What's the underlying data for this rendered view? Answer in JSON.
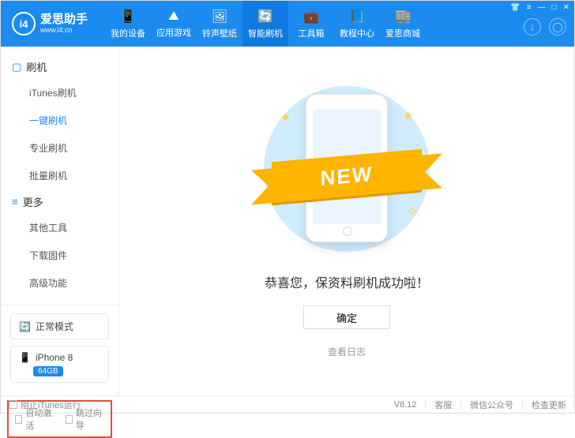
{
  "brand": {
    "icon_text": "i4",
    "name": "爱思助手",
    "site": "www.i4.cn"
  },
  "nav": [
    {
      "label": "我的设备",
      "icon": "📱"
    },
    {
      "label": "应用游戏",
      "icon": "⛰"
    },
    {
      "label": "铃声壁纸",
      "icon": "🖼"
    },
    {
      "label": "智能刷机",
      "icon": "🔄",
      "active": true
    },
    {
      "label": "工具箱",
      "icon": "💼"
    },
    {
      "label": "教程中心",
      "icon": "📘"
    },
    {
      "label": "爱思商城",
      "icon": "🏬"
    }
  ],
  "sidebar": {
    "groups": [
      {
        "title": "刷机",
        "icon": "▢",
        "items": [
          {
            "label": "iTunes刷机"
          },
          {
            "label": "一键刷机",
            "active": true
          },
          {
            "label": "专业刷机"
          },
          {
            "label": "批量刷机"
          }
        ]
      },
      {
        "title": "更多",
        "icon": "≡",
        "items": [
          {
            "label": "其他工具"
          },
          {
            "label": "下载固件"
          },
          {
            "label": "高级功能"
          }
        ]
      }
    ],
    "mode": {
      "label": "正常模式",
      "icon": "🔄"
    },
    "device": {
      "name": "iPhone 8",
      "storage": "64GB",
      "icon": "📱"
    },
    "checks": {
      "auto_activate": "自动激活",
      "skip_guide": "跳过向导"
    }
  },
  "main": {
    "ribbon": "NEW",
    "success": "恭喜您，保资料刷机成功啦！",
    "ok": "确定",
    "view_log": "查看日志"
  },
  "footer": {
    "block_itunes": "阻止iTunes运行",
    "version": "V8.12",
    "support": "客服",
    "wechat": "微信公众号",
    "update": "检查更新"
  }
}
